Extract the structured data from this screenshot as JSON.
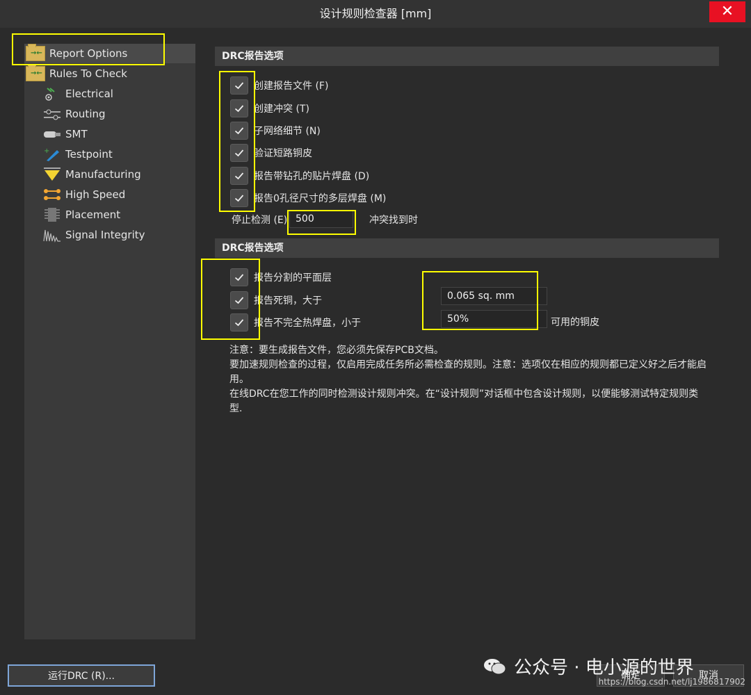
{
  "window": {
    "title": "设计规则检查器 [mm]",
    "close_glyph": "✕"
  },
  "tree": {
    "items": [
      {
        "label": "Report Options",
        "icon": "folder-icon",
        "indent": 0
      },
      {
        "label": "Rules To Check",
        "icon": "folder-icon",
        "indent": 0
      },
      {
        "label": "Electrical",
        "icon": "electrical-icon",
        "indent": 1
      },
      {
        "label": "Routing",
        "icon": "routing-icon",
        "indent": 1
      },
      {
        "label": "SMT",
        "icon": "smt-icon",
        "indent": 1
      },
      {
        "label": "Testpoint",
        "icon": "testpoint-icon",
        "indent": 1
      },
      {
        "label": "Manufacturing",
        "icon": "manufacturing-icon",
        "indent": 1
      },
      {
        "label": "High Speed",
        "icon": "high-speed-icon",
        "indent": 1
      },
      {
        "label": "Placement",
        "icon": "placement-icon",
        "indent": 1
      },
      {
        "label": "Signal Integrity",
        "icon": "signal-integrity-icon",
        "indent": 1
      }
    ]
  },
  "section1": {
    "header": "DRC报告选项",
    "checkboxes": [
      {
        "label": "创建报告文件 (F)",
        "checked": true
      },
      {
        "label": "创建冲突 (T)",
        "checked": true
      },
      {
        "label": "子网络细节 (N)",
        "checked": true
      },
      {
        "label": "验证短路铜皮",
        "checked": true
      },
      {
        "label": "报告带钻孔的贴片焊盘 (D)",
        "checked": true
      },
      {
        "label": "报告0孔径尺寸的多层焊盘 (M)",
        "checked": true
      }
    ],
    "stop_label": "停止检测 (E)",
    "stop_value": "500",
    "stop_suffix": "冲突找到时"
  },
  "section2": {
    "header": "DRC报告选项",
    "checkboxes": [
      {
        "label": "报告分割的平面层",
        "checked": true
      },
      {
        "label": "报告死铜，大于",
        "checked": true
      },
      {
        "label": "报告不完全热焊盘，小于",
        "checked": true
      }
    ],
    "dead_copper_value": "0.065 sq. mm",
    "thermal_value": "50%",
    "thermal_suffix": "可用的铜皮"
  },
  "note": {
    "lines": [
      "注意：要生成报告文件，您必须先保存PCB文档。",
      "要加速规则检查的过程，仅启用完成任务所必需检查的规则。注意：选项仅在相应的规则都已定义好之后才能启用。",
      "在线DRC在您工作的同时检测设计规则冲突。在“设计规则”对话框中包含设计规则，以便能够测试特定规则类型."
    ]
  },
  "buttons": {
    "run": "运行DRC (R)...",
    "ok": "确定",
    "cancel": "取消"
  },
  "watermark": {
    "text": "公众号 · 电小源的世界",
    "url": "https://blog.csdn.net/lj1986817902"
  },
  "colors": {
    "highlight": "#ffff00",
    "close_bg": "#e81123",
    "folder": "#d8b75a"
  }
}
